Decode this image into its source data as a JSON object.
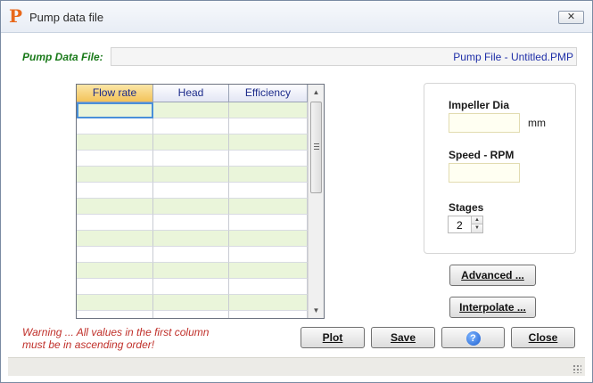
{
  "window": {
    "title": "Pump data file",
    "close_label": "✕"
  },
  "file": {
    "label": "Pump Data File:",
    "value": "Pump File - Untitled.PMP"
  },
  "grid": {
    "columns": [
      "Flow rate",
      "Head",
      "Efficiency"
    ],
    "active_column": 0,
    "rows": [
      [
        "",
        "",
        ""
      ],
      [
        "",
        "",
        ""
      ],
      [
        "",
        "",
        ""
      ],
      [
        "",
        "",
        ""
      ],
      [
        "",
        "",
        ""
      ],
      [
        "",
        "",
        ""
      ],
      [
        "",
        "",
        ""
      ],
      [
        "",
        "",
        ""
      ],
      [
        "",
        "",
        ""
      ],
      [
        "",
        "",
        ""
      ],
      [
        "",
        "",
        ""
      ],
      [
        "",
        "",
        ""
      ],
      [
        "",
        "",
        ""
      ],
      [
        "",
        "",
        ""
      ]
    ]
  },
  "panel": {
    "impeller_label": "Impeller Dia",
    "impeller_value": "",
    "impeller_unit": "mm",
    "speed_label": "Speed - RPM",
    "speed_value": "",
    "stages_label": "Stages",
    "stages_value": "2"
  },
  "buttons": {
    "advanced": "Advanced ...",
    "interpolate": "Interpolate ...",
    "plot": "Plot",
    "save": "Save",
    "help": "?",
    "close": "Close"
  },
  "warning": {
    "line1": "Warning ... All values in the first column",
    "line2": "must be in ascending order!"
  },
  "colors": {
    "accent_orange": "#e8681a",
    "label_green": "#1a7a1a",
    "file_text_blue": "#1f2fa8",
    "warning_red": "#c0302a",
    "row_alt_green": "#eaf5da",
    "header_active": "#f3c35a"
  }
}
